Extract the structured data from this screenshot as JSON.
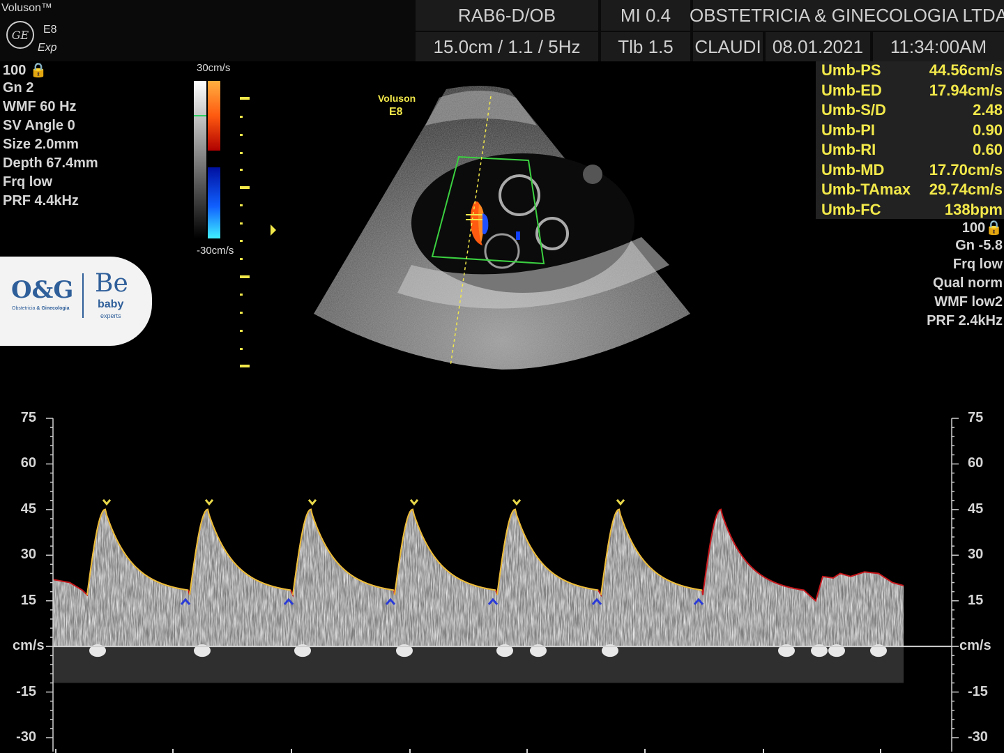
{
  "header": {
    "brand": "Voluson™",
    "logo_text": "GE",
    "model": "E8",
    "variant": "Exp",
    "probe": "RAB6-D/OB",
    "mi": "MI  0.4",
    "institution": "OBSTETRICIA & GINECOLOGIA LTDA",
    "depth_freq": "15.0cm / 1.1 /  5Hz",
    "tib": "Tlb  1.5",
    "operator": "CLAUDI",
    "date": "08.01.2021",
    "time": "11:34:00AM"
  },
  "left_params": [
    "100 🔒",
    "Gn  2",
    "WMF 60 Hz",
    " SV Angle  0",
    " Size  2.0mm",
    "Depth 67.4mm",
    "Frq low",
    "PRF  4.4kHz"
  ],
  "colorbar": {
    "top_label": "30cm/s",
    "bottom_label": "-30cm/s"
  },
  "image_overlay": {
    "line1": "Voluson",
    "line2": "E8"
  },
  "measurements": [
    {
      "label": "Umb-PS",
      "value": "44.56cm/s"
    },
    {
      "label": "Umb-ED",
      "value": "17.94cm/s"
    },
    {
      "label": "Umb-S/D",
      "value": "2.48"
    },
    {
      "label": "Umb-PI",
      "value": "0.90"
    },
    {
      "label": "Umb-RI",
      "value": "0.60"
    },
    {
      "label": "Umb-MD",
      "value": "17.70cm/s"
    },
    {
      "label": "Umb-TAmax",
      "value": "29.74cm/s"
    },
    {
      "label": "Umb-FC",
      "value": "138bpm"
    }
  ],
  "right_params": [
    "100🔒",
    "Gn -5.8",
    "Frq low",
    "Qual norm",
    "WMF low2",
    "PRF  2.4kHz"
  ],
  "logo": {
    "og": "O&G",
    "og_sub_left": "Obstetricia",
    "og_sub_amp": "&",
    "og_sub_right": "Ginecologia",
    "be": "Be",
    "baby": "baby",
    "experts": "experts"
  },
  "spectral": {
    "unit": "cm/s",
    "ticks": [
      "75",
      "60",
      "45",
      "30",
      "15",
      "-15",
      "-30"
    ],
    "tick_values": [
      75,
      60,
      45,
      30,
      15,
      -15,
      -30
    ],
    "ymin": -30,
    "ymax": 75,
    "peak_velocity": 44.56,
    "end_diastolic_velocity": 17.94,
    "heart_rate_bpm": 138,
    "colors": {
      "traced": "#e9c23b",
      "live": "#c8181c",
      "peak_marker": "#e8d84a",
      "ed_marker": "#2a3bd8"
    }
  }
}
